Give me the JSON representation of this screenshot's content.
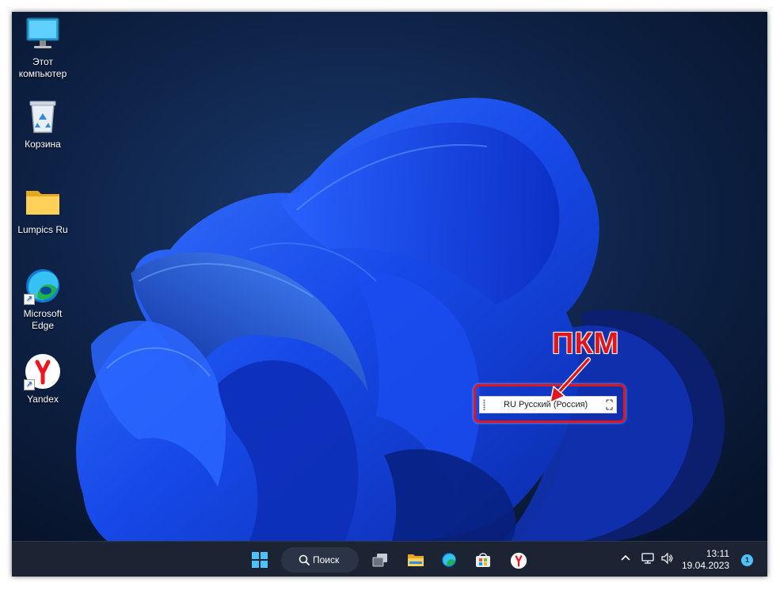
{
  "desktop": {
    "icons": [
      {
        "label_line1": "Этот",
        "label_line2": "компьютер",
        "icon": "monitor-icon"
      },
      {
        "label_line1": "Корзина",
        "label_line2": "",
        "icon": "recycle-bin-icon"
      },
      {
        "label_line1": "Lumpics Ru",
        "label_line2": "",
        "icon": "folder-icon"
      },
      {
        "label_line1": "Microsoft",
        "label_line2": "Edge",
        "icon": "edge-icon"
      },
      {
        "label_line1": "Yandex",
        "label_line2": "",
        "icon": "yandex-icon"
      }
    ]
  },
  "language_bar": {
    "text": "RU Русский (Россия)"
  },
  "annotation": {
    "label": "ПКМ",
    "color": "#e0161e"
  },
  "taskbar": {
    "search_label": "Поиск",
    "apps": [
      "start-icon",
      "search-icon",
      "task-view-icon",
      "file-explorer-icon",
      "edge-icon",
      "store-icon",
      "yandex-icon"
    ],
    "tray": {
      "time": "13:11",
      "date": "19.04.2023",
      "notifications": "1"
    }
  },
  "colors": {
    "taskbar_bg": "#1c2433",
    "wallpaper_bg": "#0b1a33",
    "wallpaper_accent": "#1f5bff"
  }
}
